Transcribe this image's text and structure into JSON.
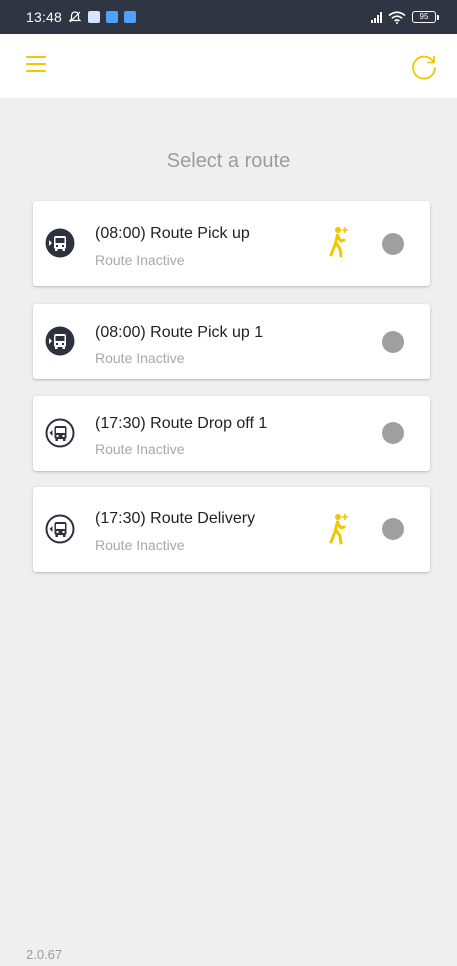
{
  "status_bar": {
    "time": "13:48",
    "battery": "95"
  },
  "app_bar": {
    "menu_icon": "hamburger-menu-icon",
    "refresh_icon": "refresh-icon"
  },
  "page": {
    "title": "Select a route"
  },
  "routes": [
    {
      "name": "(08:00) Route Pick up",
      "status": "Route Inactive",
      "icon": "bus-pickup-icon",
      "has_walker": true
    },
    {
      "name": "(08:00) Route Pick up 1",
      "status": "Route Inactive",
      "icon": "bus-pickup-icon",
      "has_walker": false
    },
    {
      "name": "(17:30) Route Drop off 1",
      "status": "Route Inactive",
      "icon": "bus-dropoff-icon",
      "has_walker": false
    },
    {
      "name": "(17:30) Route Delivery",
      "status": "Route Inactive",
      "icon": "bus-dropoff-icon",
      "has_walker": true
    }
  ],
  "colors": {
    "accent": "#f2c600",
    "status_inactive": "#9f9f9f",
    "status_bar_bg": "#2f3542",
    "page_bg": "#efefef"
  },
  "footer": {
    "version": "2.0.67"
  }
}
